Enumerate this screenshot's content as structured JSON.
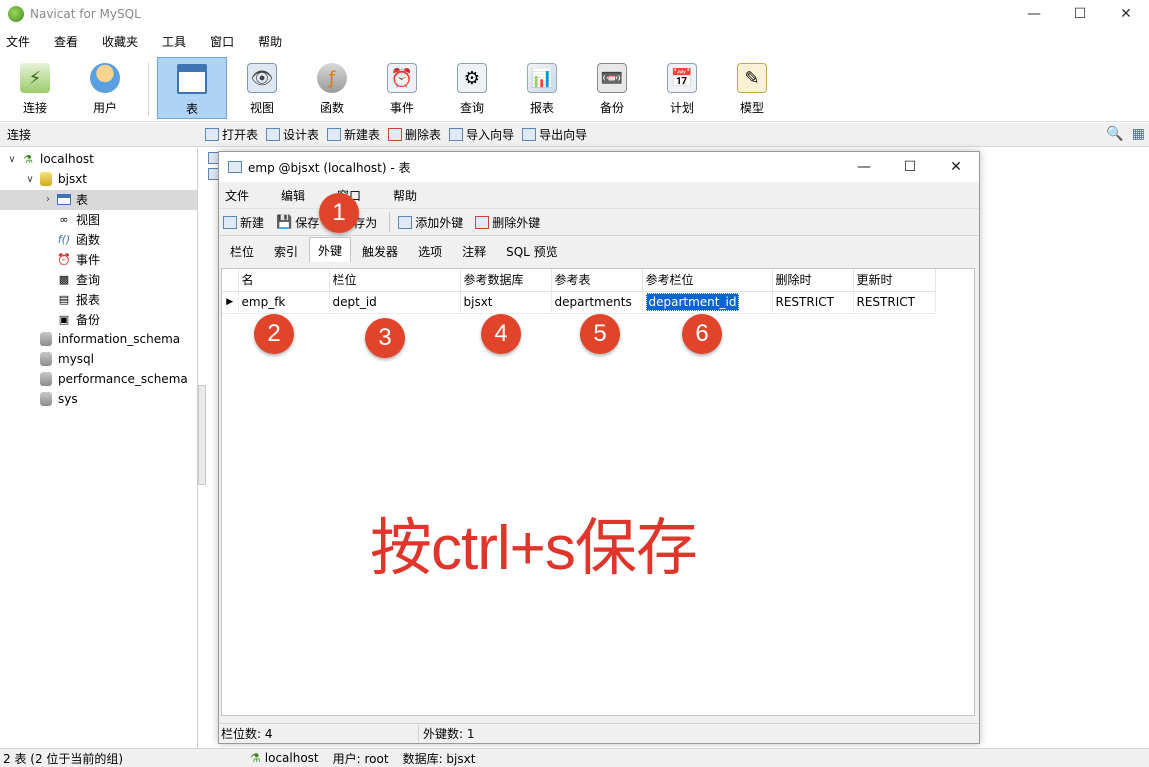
{
  "app": {
    "title": "Navicat for MySQL"
  },
  "menu": [
    "文件",
    "查看",
    "收藏夹",
    "工具",
    "窗口",
    "帮助"
  ],
  "toolbar": [
    {
      "label": "连接",
      "icon": "connect-icon"
    },
    {
      "label": "用户",
      "icon": "user-icon"
    },
    {
      "label": "表",
      "icon": "table-icon",
      "active": true
    },
    {
      "label": "视图",
      "icon": "view-icon"
    },
    {
      "label": "函数",
      "icon": "function-icon"
    },
    {
      "label": "事件",
      "icon": "event-icon"
    },
    {
      "label": "查询",
      "icon": "query-icon"
    },
    {
      "label": "报表",
      "icon": "report-icon"
    },
    {
      "label": "备份",
      "icon": "backup-icon"
    },
    {
      "label": "计划",
      "icon": "schedule-icon"
    },
    {
      "label": "模型",
      "icon": "model-icon"
    }
  ],
  "subbar": {
    "connection_label": "连接",
    "actions": [
      "打开表",
      "设计表",
      "新建表",
      "删除表",
      "导入向导",
      "导出向导"
    ]
  },
  "tree": {
    "server": "localhost",
    "database": "bjsxt",
    "children": [
      "表",
      "视图",
      "函数",
      "事件",
      "查询",
      "报表",
      "备份"
    ],
    "other_dbs": [
      "information_schema",
      "mysql",
      "performance_schema",
      "sys"
    ]
  },
  "status": {
    "left": "2 表 (2 位于当前的组)",
    "server": "localhost",
    "user": "用户: root",
    "database": "数据库: bjsxt"
  },
  "child": {
    "title": "emp @bjsxt (localhost) - 表",
    "menu": [
      "文件",
      "编辑",
      "窗口",
      "帮助"
    ],
    "tools": [
      "新建",
      "保存",
      "另存为",
      "添加外键",
      "删除外键"
    ],
    "tabs": [
      "栏位",
      "索引",
      "外键",
      "触发器",
      "选项",
      "注释",
      "SQL 预览"
    ],
    "active_tab": "外键",
    "columns": [
      "名",
      "栏位",
      "参考数据库",
      "参考表",
      "参考栏位",
      "删除时",
      "更新时"
    ],
    "row": {
      "name": "emp_fk",
      "field": "dept_id",
      "ref_db": "bjsxt",
      "ref_table": "departments",
      "ref_field": "department_id",
      "on_delete": "RESTRICT",
      "on_update": "RESTRICT"
    },
    "status_left": "栏位数: 4",
    "status_right": "外键数: 1"
  },
  "annotations": {
    "badges": [
      "1",
      "2",
      "3",
      "4",
      "5",
      "6"
    ],
    "note": "按ctrl+s保存"
  },
  "colors": {
    "selection": "#0a64d6",
    "badge": "#e0452b",
    "active_tool": "#aed3f3"
  }
}
